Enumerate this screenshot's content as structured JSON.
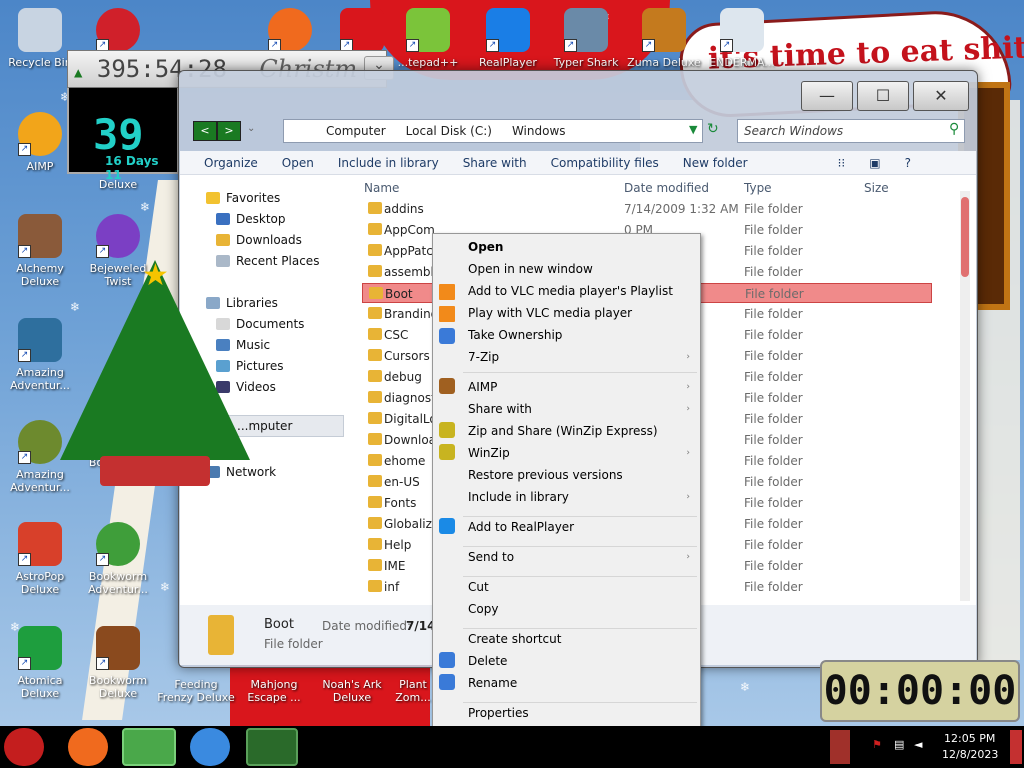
{
  "desktop": {
    "banner_text": "it's time to eat shit",
    "gadget_counter": "395:54:28",
    "gadget_label": "Christm",
    "countdown_big": "39",
    "countdown_sub": "16 Days 11",
    "icons": [
      {
        "label": "Recycle Bin"
      },
      {
        "label": "AIMP"
      },
      {
        "label": "Deluxe"
      },
      {
        "label": "Alchemy Deluxe"
      },
      {
        "label": "Bejeweled Twist"
      },
      {
        "label": "Amazing Adventur..."
      },
      {
        "label": "Amazing Adventur..."
      },
      {
        "label": "Bookstor..."
      },
      {
        "label": "AstroPop Deluxe"
      },
      {
        "label": "Bookworm Adventur..."
      },
      {
        "label": "Atomica Deluxe"
      },
      {
        "label": "Bookworm Deluxe"
      },
      {
        "label": "Feeding Frenzy Deluxe"
      },
      {
        "label": "Mahjong Escape ..."
      },
      {
        "label": "Noah's Ark Deluxe"
      },
      {
        "label": "Plant Zom..."
      },
      {
        "label": "...tepad++"
      },
      {
        "label": "RealPlayer"
      },
      {
        "label": "Typer Shark"
      },
      {
        "label": "Zuma Deluxe"
      },
      {
        "label": "ENDERMA..."
      }
    ]
  },
  "explorer": {
    "crumbs": [
      "Computer",
      "Local Disk (C:)",
      "Windows"
    ],
    "search_placeholder": "Search Windows",
    "commands": [
      "Organize",
      "Open",
      "Include in library",
      "Share with",
      "Compatibility files",
      "New folder"
    ],
    "nav": {
      "favorites": "Favorites",
      "fav_items": [
        "Desktop",
        "Downloads",
        "Recent Places"
      ],
      "libraries": "Libraries",
      "lib_items": [
        "Documents",
        "Music",
        "Pictures",
        "Videos"
      ],
      "computer": "...mputer",
      "network": "Network"
    },
    "columns": {
      "name": "Name",
      "date": "Date modified",
      "type": "Type",
      "size": "Size"
    },
    "rows": [
      {
        "name": "addins",
        "date": "7/14/2009 1:32 AM",
        "type": "File folder"
      },
      {
        "name": "AppCom",
        "date": "0 PM",
        "type": "File folder"
      },
      {
        "name": "AppPatch",
        "date": "0 PM",
        "type": "File folder"
      },
      {
        "name": "assembly",
        "date": "3 AM",
        "type": "File folder"
      },
      {
        "name": "Boot",
        "date": "AM",
        "type": "File folder"
      },
      {
        "name": "Branding",
        "date": "AM",
        "type": "File folder"
      },
      {
        "name": "CSC",
        "date": "9 PM",
        "type": "File folder"
      },
      {
        "name": "Cursors",
        "date": "31 ...",
        "type": "File folder"
      },
      {
        "name": "debug",
        "date": "1 PM",
        "type": "File folder"
      },
      {
        "name": "diagnosti",
        "date": "AM",
        "type": "File folder"
      },
      {
        "name": "DigitalLo",
        "date": "AM",
        "type": "File folder"
      },
      {
        "name": "Downloa",
        "date": "AM",
        "type": "File folder"
      },
      {
        "name": "ehome",
        "date": "AM",
        "type": "File folder"
      },
      {
        "name": "en-US",
        "date": "AM",
        "type": "File folder"
      },
      {
        "name": "Fonts",
        "date": "3 PM",
        "type": "File folder"
      },
      {
        "name": "Globaliza",
        "date": "AM",
        "type": "File folder"
      },
      {
        "name": "Help",
        "date": "AM",
        "type": "File folder"
      },
      {
        "name": "IME",
        "date": "AM",
        "type": "File folder"
      },
      {
        "name": "inf",
        "date": "5 PM",
        "type": "File folder"
      }
    ],
    "details": {
      "name": "Boot",
      "type": "File folder",
      "date_label": "Date modified:",
      "date_value": "7/14,"
    }
  },
  "context_menu": [
    {
      "label": "Open",
      "bold": true
    },
    {
      "label": "Open in new window"
    },
    {
      "label": "Add to VLC media player's Playlist"
    },
    {
      "label": "Play with VLC media player"
    },
    {
      "label": "Take Ownership"
    },
    {
      "label": "7-Zip"
    },
    {
      "label": "AIMP"
    },
    {
      "label": "Share with"
    },
    {
      "label": "Zip and Share (WinZip Express)"
    },
    {
      "label": "WinZip"
    },
    {
      "label": "Restore previous versions"
    },
    {
      "label": "Include in library"
    },
    {
      "label": "Add to RealPlayer"
    },
    {
      "label": "Send to"
    },
    {
      "label": "Cut"
    },
    {
      "label": "Copy"
    },
    {
      "label": "Create shortcut"
    },
    {
      "label": "Delete"
    },
    {
      "label": "Rename"
    },
    {
      "label": "Properties"
    }
  ],
  "clock_gadget": "00:00:00",
  "taskbar": {
    "time": "12:05 PM",
    "date": "12/8/2023"
  },
  "colors": {
    "selection": "#f08a8a",
    "folder": "#e8b436",
    "accent_green": "#1a7a22"
  }
}
